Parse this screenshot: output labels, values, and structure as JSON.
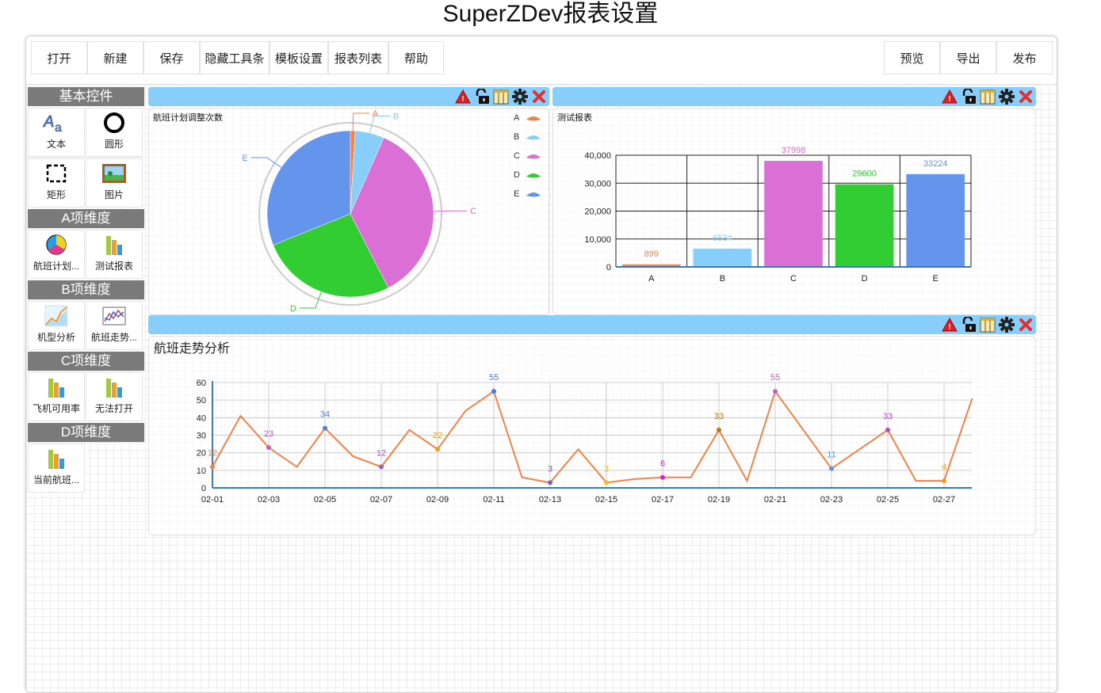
{
  "page": {
    "title": "SuperZDev报表设置"
  },
  "toolbar": {
    "left": [
      "打开",
      "新建",
      "保存",
      "隐藏工具条",
      "模板设置",
      "报表列表",
      "帮助"
    ],
    "right": [
      "预览",
      "导出",
      "发布"
    ]
  },
  "sidebar": {
    "sections": [
      {
        "title": "基本控件",
        "items": [
          {
            "label": "文本",
            "icon": "text-icon"
          },
          {
            "label": "圆形",
            "icon": "circle-icon"
          },
          {
            "label": "矩形",
            "icon": "rectangle-icon"
          },
          {
            "label": "图片",
            "icon": "image-icon"
          }
        ]
      },
      {
        "title": "A项维度",
        "items": [
          {
            "label": "航班计划...",
            "icon": "pie-chart-icon"
          },
          {
            "label": "测试报表",
            "icon": "bar-chart-icon"
          }
        ]
      },
      {
        "title": "B项维度",
        "items": [
          {
            "label": "机型分析",
            "icon": "line-chart-icon"
          },
          {
            "label": "航班走势...",
            "icon": "area-chart-icon"
          }
        ]
      },
      {
        "title": "C项维度",
        "items": [
          {
            "label": "飞机可用率",
            "icon": "bar-chart-icon"
          },
          {
            "label": "无法打开",
            "icon": "bar-chart-icon"
          }
        ]
      },
      {
        "title": "D项维度",
        "items": [
          {
            "label": "当前航班...",
            "icon": "bar-chart-icon"
          }
        ]
      }
    ]
  },
  "panel_icons": [
    "warning-icon",
    "unlock-icon",
    "columns-icon",
    "gear-icon",
    "close-icon"
  ],
  "colors": {
    "header": "#87cefa",
    "A": "#f28348",
    "B": "#87cefa",
    "C": "#da70d6",
    "D": "#32cd32",
    "E": "#6495ed"
  },
  "chart_data": [
    {
      "type": "pie",
      "title": "航班计划调整次数",
      "categories": [
        "A",
        "B",
        "C",
        "D",
        "E"
      ],
      "values": [
        1,
        6,
        38,
        28,
        33
      ],
      "legend": "top-right"
    },
    {
      "type": "bar",
      "title": "测试报表",
      "categories": [
        "A",
        "B",
        "C",
        "D",
        "E"
      ],
      "values": [
        899,
        6534,
        37998,
        29600,
        33224
      ],
      "ylim": [
        0,
        40000
      ],
      "yticks": [
        "0",
        "10,000",
        "20,000",
        "30,000",
        "40,000"
      ]
    },
    {
      "type": "line",
      "title": "航班走势分析",
      "x": [
        "02-01",
        "02-02",
        "02-03",
        "02-04",
        "02-05",
        "02-06",
        "02-07",
        "02-08",
        "02-09",
        "02-10",
        "02-11",
        "02-12",
        "02-13",
        "02-14",
        "02-15",
        "02-16",
        "02-17",
        "02-18",
        "02-19",
        "02-20",
        "02-21",
        "02-22",
        "02-23",
        "02-24",
        "02-25",
        "02-26",
        "02-27",
        "02-28"
      ],
      "xticks": [
        "02-01",
        "02-03",
        "02-05",
        "02-07",
        "02-09",
        "02-11",
        "02-13",
        "02-15",
        "02-17",
        "02-19",
        "02-21",
        "02-23",
        "02-25",
        "02-27"
      ],
      "values": [
        12,
        41,
        23,
        12,
        34,
        18,
        12,
        33,
        22,
        44,
        55,
        6,
        3,
        22,
        3,
        5,
        6,
        6,
        33,
        4,
        55,
        33,
        11,
        22,
        33,
        4,
        4,
        51
      ],
      "labeled_points": [
        {
          "i": 0,
          "v": "12",
          "color": "#e0894a"
        },
        {
          "i": 2,
          "v": "23",
          "color": "#c060c0"
        },
        {
          "i": 4,
          "v": "34",
          "color": "#5a7fd0"
        },
        {
          "i": 6,
          "v": "12",
          "color": "#9a5fc0"
        },
        {
          "i": 8,
          "v": "22",
          "color": "#e0a020"
        },
        {
          "i": 10,
          "v": "55",
          "color": "#3a80d0"
        },
        {
          "i": 12,
          "v": "3",
          "color": "#7a60c0"
        },
        {
          "i": 14,
          "v": "3",
          "color": "#f0c020"
        },
        {
          "i": 16,
          "v": "6",
          "color": "#e020c0"
        },
        {
          "i": 18,
          "v": "33",
          "color": "#b08010"
        },
        {
          "i": 20,
          "v": "55",
          "color": "#c060c0"
        },
        {
          "i": 22,
          "v": "11",
          "color": "#5a9ad0"
        },
        {
          "i": 24,
          "v": "33",
          "color": "#b050c0"
        },
        {
          "i": 26,
          "v": "4",
          "color": "#f0a020"
        }
      ],
      "ylim": [
        0,
        60
      ],
      "yticks": [
        "0",
        "10",
        "20",
        "30",
        "40",
        "50",
        "60"
      ],
      "line_color": "#f28348"
    }
  ]
}
